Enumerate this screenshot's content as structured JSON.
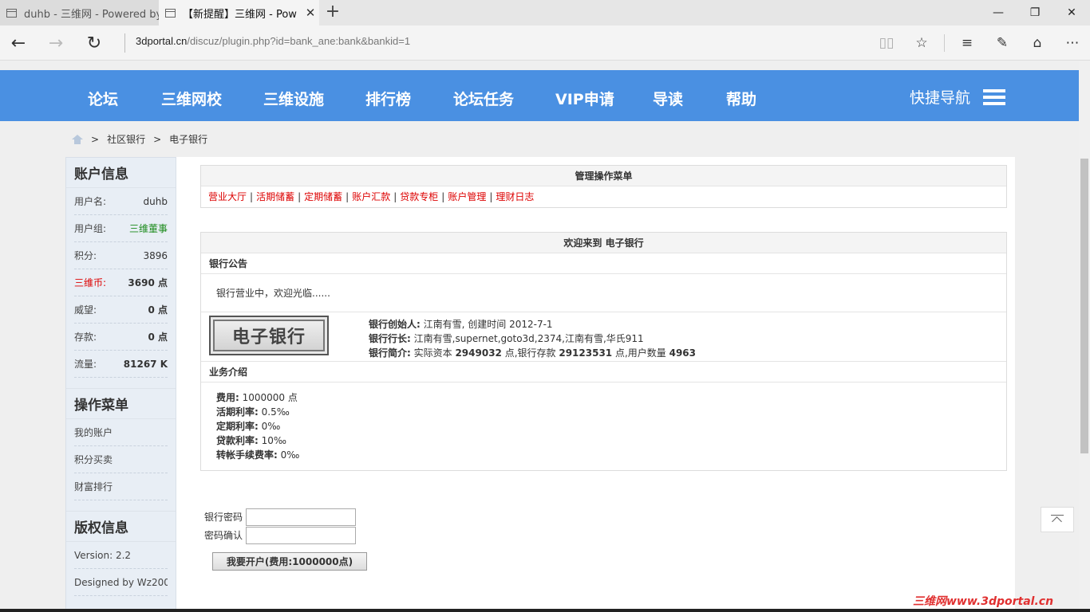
{
  "browser": {
    "tabs": [
      {
        "title": "duhb - 三维网 - Powered by"
      },
      {
        "title": "【新提醒】三维网 - Pow"
      }
    ],
    "url_host": "3dportal.cn",
    "url_path": "/discuz/plugin.php?id=bank_ane:bank&bankid=1"
  },
  "nav": {
    "items": [
      "论坛",
      "三维网校",
      "三维设施",
      "排行榜",
      "论坛任务",
      "VIP申请",
      "导读",
      "帮助"
    ],
    "quick": "快捷导航"
  },
  "breadcrumb": [
    "社区银行",
    "电子银行"
  ],
  "crumb_separator": ">",
  "sidebar": {
    "account_title": "账户信息",
    "account": [
      {
        "key": "用户名:",
        "value": "duhb"
      },
      {
        "key": "用户组:",
        "value": "三维董事"
      },
      {
        "key": "积分:",
        "value": "3896"
      },
      {
        "key": "三维币:",
        "value": "3690 点"
      },
      {
        "key": "威望:",
        "value": "0 点"
      },
      {
        "key": "存款:",
        "value": "0 点"
      },
      {
        "key": "流量:",
        "value": "81267 K"
      }
    ],
    "menu_title": "操作菜单",
    "menu": [
      "我的账户",
      "积分买卖",
      "财富排行"
    ],
    "copyright_title": "版权信息",
    "copyright": [
      "Version: 2.2",
      "Designed by Wz200..."
    ]
  },
  "admin_menu": {
    "title": "管理操作菜单",
    "links": [
      "营业大厅",
      "活期储蓄",
      "定期储蓄",
      "账户汇款",
      "贷款专柜",
      "账户管理",
      "理财日志"
    ],
    "separator": "|"
  },
  "welcome": {
    "title": "欢迎来到 电子银行",
    "notice_head": "银行公告",
    "notice_text": "银行营业中，欢迎光临......",
    "logo_text": "电子银行",
    "founder_label": "银行创始人:",
    "founder_value": " 江南有雪, 创建时间 2012-7-1",
    "president_label": "银行行长:",
    "president_value": " 江南有雪,supernet,goto3d,2374,江南有雪,华氏911",
    "intro_label": "银行简介:",
    "intro_p1": " 实际资本 ",
    "capital": "2949032",
    "intro_p2": " 点,银行存款 ",
    "deposit": "29123531",
    "intro_p3": " 点,用户数量 ",
    "users": "4963",
    "business_head": "业务介绍",
    "business": [
      {
        "label": "费用:",
        "value": " 1000000 点"
      },
      {
        "label": "活期利率:",
        "value": " 0.5‰"
      },
      {
        "label": "定期利率:",
        "value": " 0‰"
      },
      {
        "label": "贷款利率:",
        "value": " 10‰"
      },
      {
        "label": "转帐手续费率:",
        "value": " 0‰"
      }
    ]
  },
  "form": {
    "password_label": "银行密码",
    "confirm_label": "密码确认",
    "submit": "我要开户(费用:1000000点)"
  },
  "watermark": "三维网www.3dportal.cn"
}
